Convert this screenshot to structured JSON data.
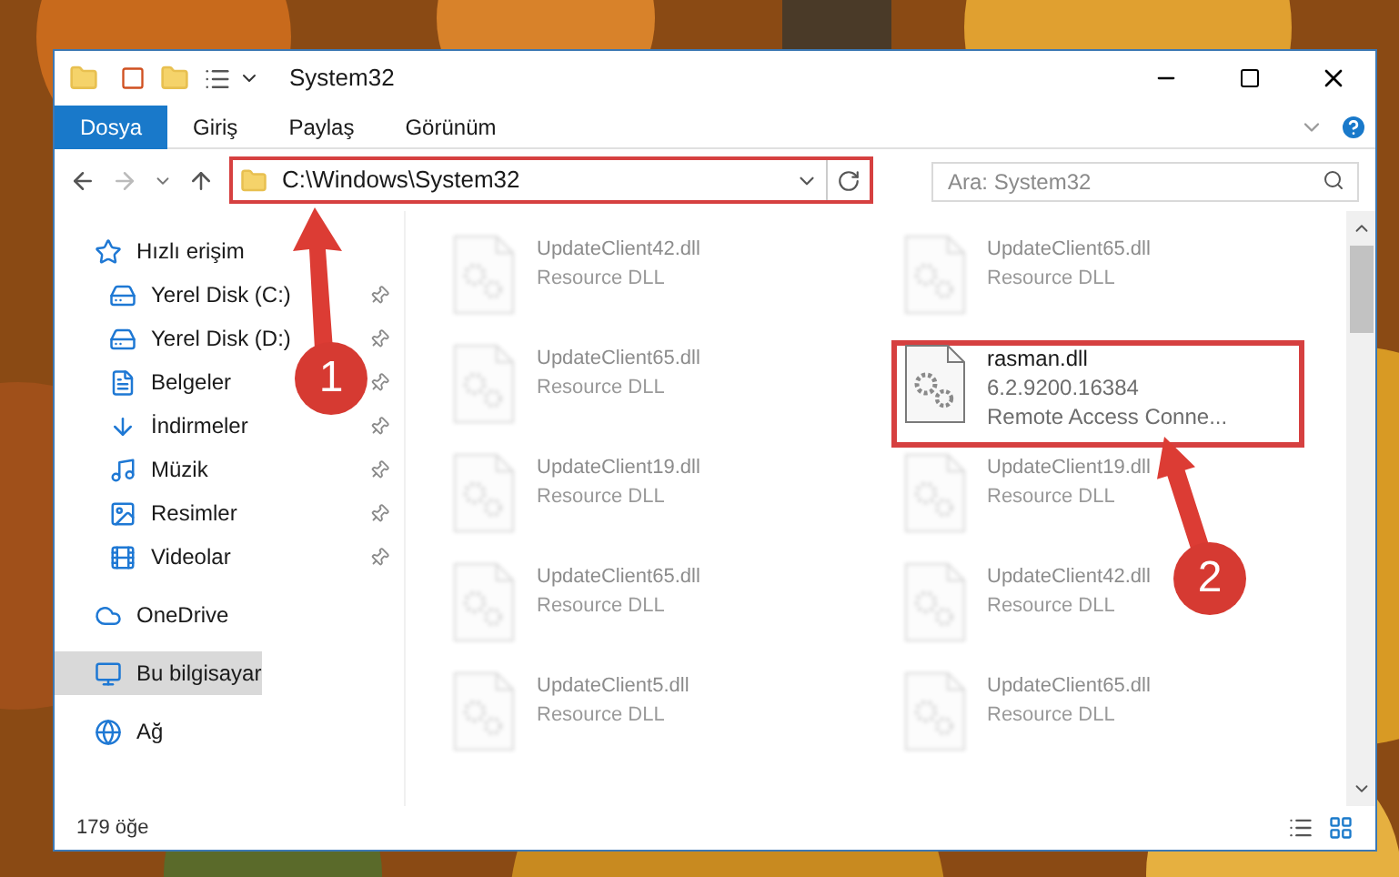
{
  "window": {
    "title": "System32"
  },
  "ribbon_tabs": [
    {
      "label": "Dosya",
      "selected": true
    },
    {
      "label": "Giriş",
      "selected": false
    },
    {
      "label": "Paylaş",
      "selected": false
    },
    {
      "label": "Görünüm",
      "selected": false
    }
  ],
  "address": {
    "path": "C:\\Windows\\System32"
  },
  "search": {
    "placeholder": "Ara: System32"
  },
  "sidebar": {
    "items": [
      {
        "label": "Hızlı erişim",
        "kind": "star",
        "selected": false,
        "children": [
          {
            "label": "Yerel Disk (C:)",
            "kind": "drive",
            "pinned": true,
            "selected": false
          },
          {
            "label": "Yerel Disk (D:)",
            "kind": "drive",
            "pinned": true,
            "selected": false
          },
          {
            "label": "Belgeler",
            "kind": "documents",
            "pinned": true,
            "selected": false
          },
          {
            "label": "İndirmeler",
            "kind": "downloads",
            "pinned": true,
            "selected": false
          },
          {
            "label": "Müzik",
            "kind": "music",
            "pinned": true,
            "selected": false
          },
          {
            "label": "Resimler",
            "kind": "pictures",
            "pinned": true,
            "selected": false
          },
          {
            "label": "Videolar",
            "kind": "videos",
            "pinned": true,
            "selected": false
          }
        ]
      },
      {
        "label": "OneDrive",
        "kind": "cloud",
        "selected": false
      },
      {
        "label": "Bu bilgisayar",
        "kind": "computer",
        "selected": true
      },
      {
        "label": "Ağ",
        "kind": "network",
        "selected": false
      }
    ]
  },
  "files": [
    {
      "name": "UpdateClient42.dll",
      "details": [
        "Resource DLL"
      ],
      "blurred": true
    },
    {
      "name": "UpdateClient65.dll",
      "details": [
        "Resource DLL"
      ],
      "blurred": true
    },
    {
      "name": "UpdateClient65.dll",
      "details": [
        "Resource DLL"
      ],
      "blurred": true
    },
    {
      "name": "rasman.dll",
      "details": [
        "6.2.9200.16384",
        "Remote Access Conne..."
      ],
      "blurred": false
    },
    {
      "name": "UpdateClient19.dll",
      "details": [
        "Resource DLL"
      ],
      "blurred": true
    },
    {
      "name": "UpdateClient19.dll",
      "details": [
        "Resource DLL"
      ],
      "blurred": true
    },
    {
      "name": "UpdateClient65.dll",
      "details": [
        "Resource DLL"
      ],
      "blurred": true
    },
    {
      "name": "UpdateClient42.dll",
      "details": [
        "Resource DLL"
      ],
      "blurred": true
    },
    {
      "name": "UpdateClient5.dll",
      "details": [
        "Resource DLL"
      ],
      "blurred": true
    },
    {
      "name": "UpdateClient65.dll",
      "details": [
        "Resource DLL"
      ],
      "blurred": true
    }
  ],
  "annotations": [
    {
      "label": "1"
    },
    {
      "label": "2"
    }
  ],
  "status_bar": {
    "item_count": "179 öğe"
  }
}
